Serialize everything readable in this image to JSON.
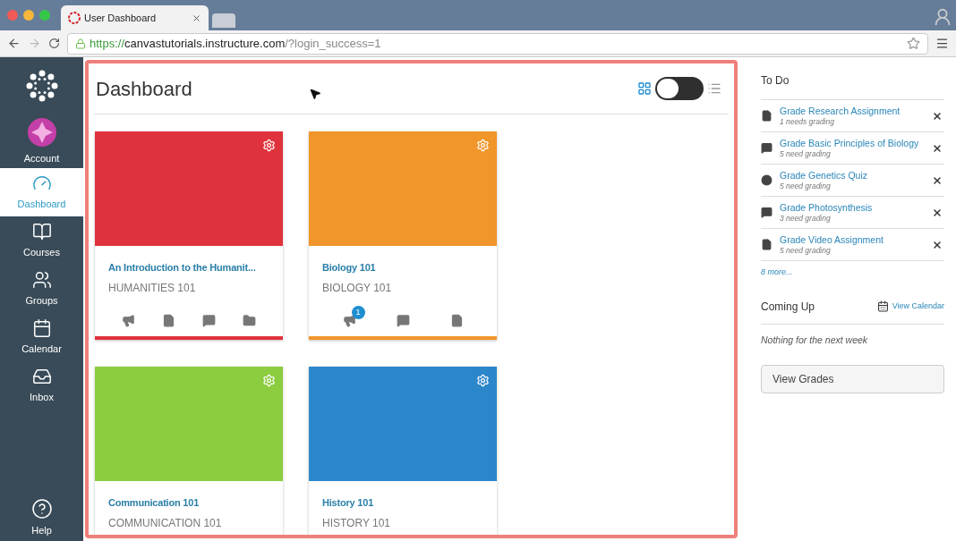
{
  "browser": {
    "tab_title": "User Dashboard",
    "url": {
      "scheme": "https://",
      "host": "canvastutorials.instructure.com",
      "path": "/?login_success=1"
    }
  },
  "nav": [
    {
      "label": "Account",
      "kind": "account",
      "selected": false
    },
    {
      "label": "Dashboard",
      "kind": "dashboard",
      "selected": true
    },
    {
      "label": "Courses",
      "kind": "courses",
      "selected": false
    },
    {
      "label": "Groups",
      "kind": "groups",
      "selected": false
    },
    {
      "label": "Calendar",
      "kind": "calendar",
      "selected": false
    },
    {
      "label": "Inbox",
      "kind": "inbox",
      "selected": false
    }
  ],
  "help": {
    "label": "Help"
  },
  "dashboard": {
    "title": "Dashboard",
    "card_view": true
  },
  "cards": [
    {
      "title": "An Introduction to the Humanit...",
      "code": "HUMANITIES 101",
      "color": "#e0323c",
      "actions": [
        {
          "kind": "announcement"
        },
        {
          "kind": "assignment"
        },
        {
          "kind": "discussion"
        },
        {
          "kind": "files"
        }
      ]
    },
    {
      "title": "Biology 101",
      "code": "BIOLOGY 101",
      "color": "#f0962a",
      "actions": [
        {
          "kind": "announcement",
          "badge": "1"
        },
        {
          "kind": "discussion"
        },
        {
          "kind": "assignment"
        }
      ]
    },
    {
      "title": "Communication 101",
      "code": "COMMUNICATION 101",
      "color": "#8ccc3f"
    },
    {
      "title": "History 101",
      "code": "HISTORY 101",
      "color": "#2c87ca"
    }
  ],
  "todo": {
    "title": "To Do",
    "items": [
      {
        "kind": "assignment",
        "title": "Grade Research Assignment",
        "subtitle": "1 needs grading"
      },
      {
        "kind": "discussion",
        "title": "Grade Basic Principles of Biology",
        "subtitle": "5 need grading"
      },
      {
        "kind": "quiz",
        "title": "Grade Genetics Quiz",
        "subtitle": "5 need grading"
      },
      {
        "kind": "discussion",
        "title": "Grade Photosynthesis",
        "subtitle": "3 need grading"
      },
      {
        "kind": "assignment",
        "title": "Grade Video Assignment",
        "subtitle": "5 need grading"
      }
    ],
    "more": "8 more..."
  },
  "coming_up": {
    "title": "Coming Up",
    "calendar_link": "View Calendar",
    "empty": "Nothing for the next week"
  },
  "view_grades": "View Grades"
}
